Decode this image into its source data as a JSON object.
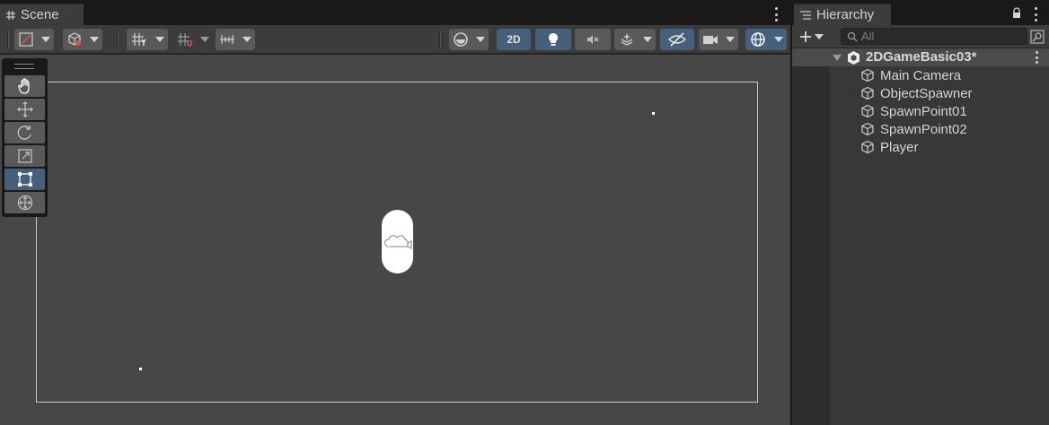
{
  "scene_tab": {
    "label": "Scene"
  },
  "hierarchy_tab": {
    "label": "Hierarchy"
  },
  "toolbar": {
    "mode_2d_label": "2D"
  },
  "hierarchy": {
    "search_placeholder": "All",
    "scene_name": "2DGameBasic03*",
    "items": [
      {
        "label": "Main Camera"
      },
      {
        "label": "ObjectSpawner"
      },
      {
        "label": "SpawnPoint01"
      },
      {
        "label": "SpawnPoint02"
      },
      {
        "label": "Player"
      }
    ]
  },
  "colors": {
    "active_tool": "#46607c",
    "panel_bg": "#383838",
    "viewport_bg": "#474747"
  }
}
